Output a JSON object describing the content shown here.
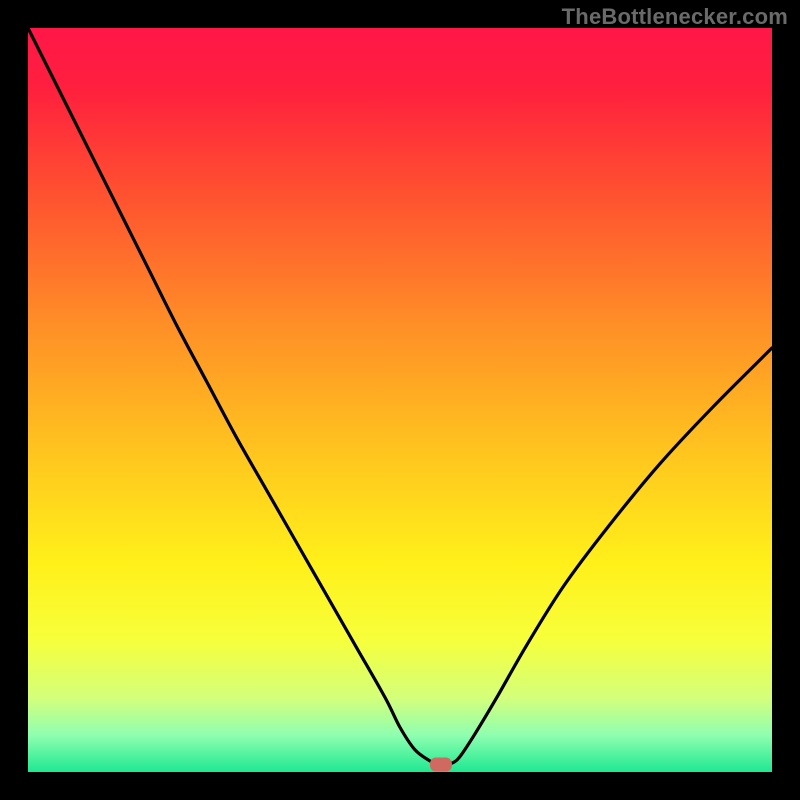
{
  "attribution": "TheBottlenecker.com",
  "chart_data": {
    "type": "line",
    "title": "",
    "xlabel": "",
    "ylabel": "",
    "xlim": [
      0,
      100
    ],
    "ylim": [
      0,
      100
    ],
    "background": "rainbow-gradient",
    "gradient_stops": [
      {
        "offset": 0.0,
        "color": "#ff1748"
      },
      {
        "offset": 0.08,
        "color": "#ff1f3e"
      },
      {
        "offset": 0.22,
        "color": "#ff5030"
      },
      {
        "offset": 0.4,
        "color": "#ff8f27"
      },
      {
        "offset": 0.58,
        "color": "#ffc81e"
      },
      {
        "offset": 0.72,
        "color": "#fff01a"
      },
      {
        "offset": 0.82,
        "color": "#f7ff3a"
      },
      {
        "offset": 0.9,
        "color": "#d4ff7a"
      },
      {
        "offset": 0.95,
        "color": "#8fffb0"
      },
      {
        "offset": 1.0,
        "color": "#1ee892"
      }
    ],
    "series": [
      {
        "name": "bottleneck-curve",
        "x": [
          0.0,
          4.0,
          8.0,
          12.0,
          16.0,
          20.0,
          24.0,
          28.0,
          32.0,
          36.0,
          40.0,
          44.0,
          48.0,
          50.0,
          52.0,
          54.0,
          55.0,
          56.0,
          57.0,
          58.0,
          60.0,
          63.0,
          67.0,
          72.0,
          78.0,
          85.0,
          92.0,
          100.0
        ],
        "y": [
          100.0,
          92.0,
          84.0,
          76.0,
          68.0,
          60.0,
          52.5,
          45.0,
          38.0,
          31.0,
          24.0,
          17.0,
          10.0,
          6.0,
          3.0,
          1.5,
          1.0,
          1.0,
          1.2,
          2.0,
          5.0,
          10.0,
          17.0,
          25.0,
          33.0,
          41.5,
          49.0,
          57.0
        ]
      }
    ],
    "marker": {
      "x": 55.5,
      "y": 1.0,
      "color": "#d06a60",
      "shape": "rounded-rect"
    }
  }
}
